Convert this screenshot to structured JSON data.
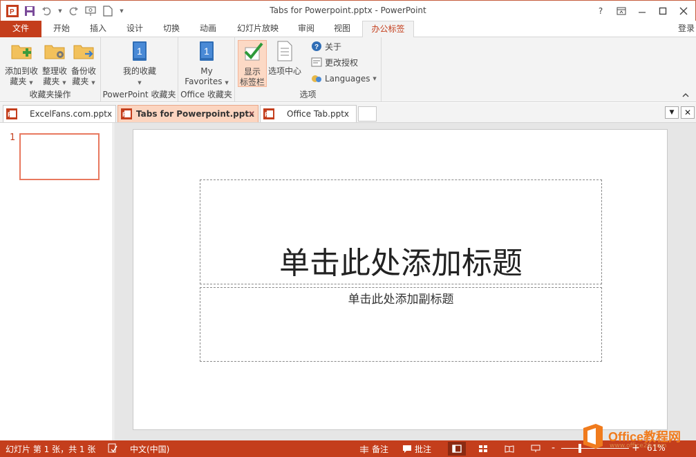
{
  "window": {
    "title": "Tabs for Powerpoint.pptx - PowerPoint",
    "help": "?",
    "login": "登录"
  },
  "ribbon_tabs": [
    "文件",
    "开始",
    "插入",
    "设计",
    "切换",
    "动画",
    "幻灯片放映",
    "审阅",
    "视图",
    "办公标签"
  ],
  "ribbon": {
    "group_favorites_ops": {
      "label": "收藏夹操作",
      "add": [
        "添加到收",
        "藏夹"
      ],
      "organize": [
        "整理收",
        "藏夹"
      ],
      "backup": [
        "备份收",
        "藏夹"
      ]
    },
    "group_pp_favorites": {
      "label": "PowerPoint 收藏夹",
      "my_fav": "我的收藏",
      "icon_number": "1"
    },
    "group_office_favorites": {
      "label": "Office 收藏夹",
      "my_favorites": [
        "My",
        "Favorites"
      ],
      "icon_number": "1"
    },
    "group_options": {
      "label": "选项",
      "show_tabbar": [
        "显示",
        "标签栏"
      ],
      "options_center": "选项中心",
      "about": "关于",
      "change_license": "更改授权",
      "languages": "Languages"
    }
  },
  "doc_tabs": [
    {
      "label": "ExcelFans.com.pptx",
      "active": false
    },
    {
      "label": "Tabs for Powerpoint.pptx",
      "active": true
    },
    {
      "label": "Office Tab.pptx",
      "active": false
    }
  ],
  "slide": {
    "number": "1",
    "title_placeholder": "单击此处添加标题",
    "subtitle_placeholder": "单击此处添加副标题"
  },
  "statusbar": {
    "slide_info": "幻灯片 第 1 张，共 1 张",
    "language": "中文(中国)",
    "notes": "备注",
    "comments": "批注",
    "zoom_minus": "-",
    "zoom_plus": "+",
    "zoom": "61%"
  },
  "watermark": {
    "text": "Office教程网",
    "url": "www.office26.com"
  },
  "colors": {
    "accent": "#c43e1c",
    "active_tab": "#fcd5c0",
    "ribbon_bg": "#f3f3f3"
  }
}
